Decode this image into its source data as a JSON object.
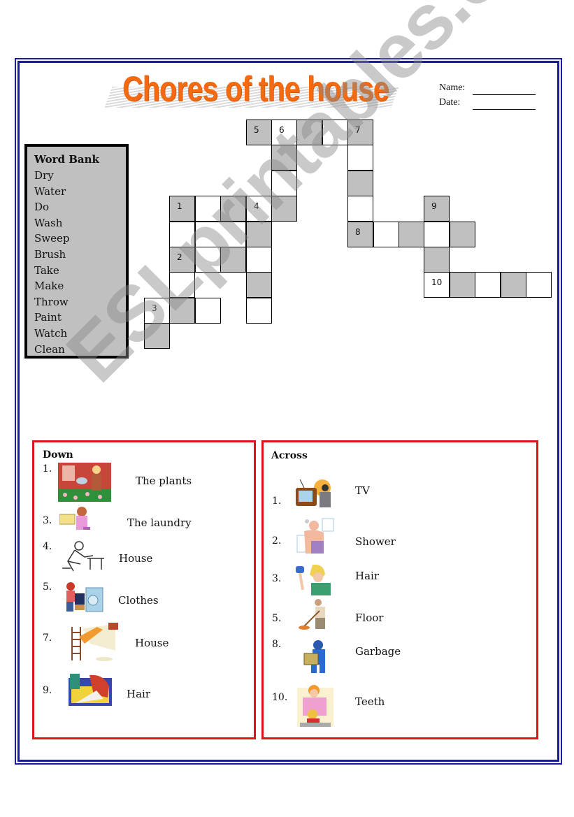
{
  "header": {
    "title": "Chores of the house",
    "name_label": "Name:",
    "date_label": "Date:"
  },
  "word_bank": {
    "heading": "Word Bank",
    "words": [
      "Dry",
      "Water",
      "Do",
      "Wash",
      "Sweep",
      "Brush",
      "Take",
      "Make",
      "Throw",
      "Paint",
      "Watch",
      "Clean"
    ]
  },
  "crossword": {
    "cells": [
      {
        "r": 0,
        "c": 4,
        "fill": "gray",
        "num": "5"
      },
      {
        "r": 0,
        "c": 5,
        "fill": "white",
        "num": "6"
      },
      {
        "r": 0,
        "c": 6,
        "fill": "gray",
        "num": ""
      },
      {
        "r": 0,
        "c": 7,
        "fill": "white",
        "num": ""
      },
      {
        "r": 0,
        "c": 8,
        "fill": "gray",
        "num": "7"
      },
      {
        "r": 1,
        "c": 5,
        "fill": "gray",
        "num": ""
      },
      {
        "r": 1,
        "c": 8,
        "fill": "white",
        "num": ""
      },
      {
        "r": 2,
        "c": 5,
        "fill": "white",
        "num": ""
      },
      {
        "r": 2,
        "c": 8,
        "fill": "gray",
        "num": ""
      },
      {
        "r": 3,
        "c": 1,
        "fill": "gray",
        "num": "1"
      },
      {
        "r": 3,
        "c": 2,
        "fill": "white",
        "num": ""
      },
      {
        "r": 3,
        "c": 3,
        "fill": "gray",
        "num": ""
      },
      {
        "r": 3,
        "c": 4,
        "fill": "white",
        "num": "4"
      },
      {
        "r": 3,
        "c": 5,
        "fill": "gray",
        "num": ""
      },
      {
        "r": 3,
        "c": 8,
        "fill": "white",
        "num": ""
      },
      {
        "r": 3,
        "c": 11,
        "fill": "gray",
        "num": "9"
      },
      {
        "r": 4,
        "c": 1,
        "fill": "white",
        "num": ""
      },
      {
        "r": 4,
        "c": 2,
        "fill": "white",
        "num": "",
        "span": 2
      },
      {
        "r": 4,
        "c": 4,
        "fill": "gray",
        "num": ""
      },
      {
        "r": 4,
        "c": 8,
        "fill": "gray",
        "num": "8"
      },
      {
        "r": 4,
        "c": 9,
        "fill": "white",
        "num": ""
      },
      {
        "r": 4,
        "c": 10,
        "fill": "gray",
        "num": ""
      },
      {
        "r": 4,
        "c": 11,
        "fill": "white",
        "num": ""
      },
      {
        "r": 4,
        "c": 12,
        "fill": "gray",
        "num": ""
      },
      {
        "r": 5,
        "c": 1,
        "fill": "gray",
        "num": "2"
      },
      {
        "r": 5,
        "c": 2,
        "fill": "white",
        "num": ""
      },
      {
        "r": 5,
        "c": 3,
        "fill": "gray",
        "num": ""
      },
      {
        "r": 5,
        "c": 4,
        "fill": "white",
        "num": ""
      },
      {
        "r": 5,
        "c": 11,
        "fill": "gray",
        "num": ""
      },
      {
        "r": 6,
        "c": 1,
        "fill": "white",
        "num": ""
      },
      {
        "r": 6,
        "c": 4,
        "fill": "gray",
        "num": ""
      },
      {
        "r": 6,
        "c": 11,
        "fill": "white",
        "num": "10"
      },
      {
        "r": 6,
        "c": 12,
        "fill": "gray",
        "num": ""
      },
      {
        "r": 6,
        "c": 13,
        "fill": "white",
        "num": ""
      },
      {
        "r": 6,
        "c": 14,
        "fill": "gray",
        "num": ""
      },
      {
        "r": 6,
        "c": 15,
        "fill": "white",
        "num": ""
      },
      {
        "r": 7,
        "c": 0,
        "fill": "white",
        "num": "3"
      },
      {
        "r": 7,
        "c": 1,
        "fill": "gray",
        "num": ""
      },
      {
        "r": 7,
        "c": 2,
        "fill": "white",
        "num": ""
      },
      {
        "r": 7,
        "c": 4,
        "fill": "white",
        "num": ""
      },
      {
        "r": 8,
        "c": 0,
        "fill": "gray",
        "num": ""
      }
    ]
  },
  "colors": {
    "title": "#f36a12",
    "page_border": "#1a1aa8",
    "panel_border": "#e01414",
    "cell_gray": "#c0c0c0"
  },
  "down": {
    "heading": "Down",
    "clues": [
      {
        "num": "1.",
        "text": "The plants",
        "icon": "watering-plants-picture"
      },
      {
        "num": "3.",
        "text": "The laundry",
        "icon": "laundry-basket-picture"
      },
      {
        "num": "4.",
        "text": "House",
        "icon": "cleaning-table-picture"
      },
      {
        "num": "5.",
        "text": "Clothes",
        "icon": "washing-machine-picture"
      },
      {
        "num": "7.",
        "text": "House",
        "icon": "painting-wall-picture"
      },
      {
        "num": "9.",
        "text": "Hair",
        "icon": "washing-hair-picture"
      }
    ]
  },
  "across": {
    "heading": "Across",
    "clues": [
      {
        "num": "1.",
        "text": "TV",
        "icon": "watching-tv-picture"
      },
      {
        "num": "2.",
        "text": "Shower",
        "icon": "shower-picture"
      },
      {
        "num": "3.",
        "text": "Hair",
        "icon": "hair-dryer-picture"
      },
      {
        "num": "5.",
        "text": "Floor",
        "icon": "sweeping-floor-picture"
      },
      {
        "num": "8.",
        "text": "Garbage",
        "icon": "garbage-picture"
      },
      {
        "num": "10.",
        "text": "Teeth",
        "icon": "brushing-teeth-picture"
      }
    ]
  },
  "watermark": "ESLprintables.com"
}
